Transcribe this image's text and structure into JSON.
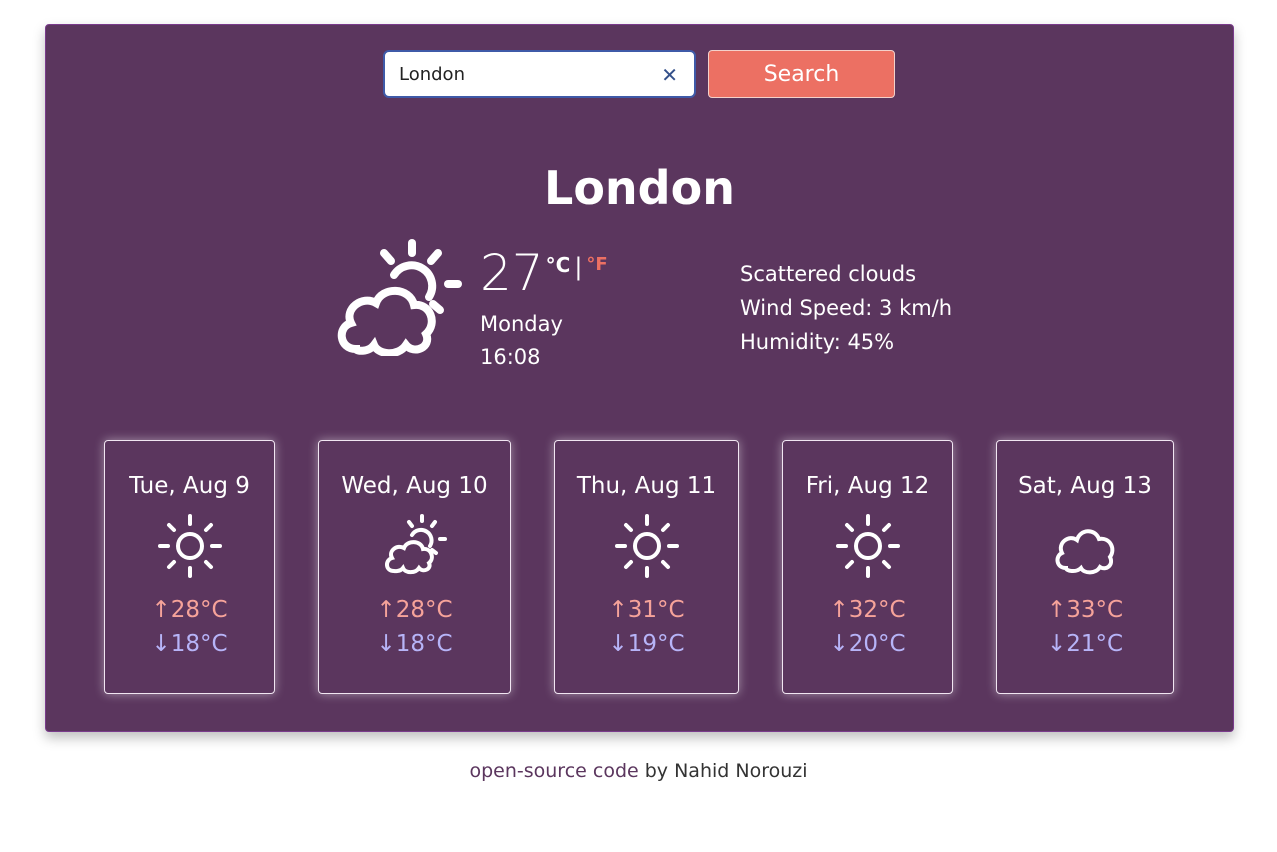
{
  "search": {
    "value": "London",
    "clear_glyph": "✕",
    "button_label": "Search"
  },
  "current": {
    "city": "London",
    "temperature": "27",
    "unit_celsius": "°C",
    "unit_separator": "|",
    "unit_fahrenheit": "°F",
    "day": "Monday",
    "time": "16:08",
    "description": "Scattered clouds",
    "wind": "Wind Speed: 3 km/h",
    "humidity": "Humidity: 45%",
    "icon": "partly-cloudy-icon"
  },
  "forecast": [
    {
      "date": "Tue, Aug 9",
      "icon": "sun-icon",
      "max": "↑28°C",
      "min": "↓18°C"
    },
    {
      "date": "Wed, Aug 10",
      "icon": "partly-cloudy-icon",
      "max": "↑28°C",
      "min": "↓18°C"
    },
    {
      "date": "Thu, Aug 11",
      "icon": "sun-icon",
      "max": "↑31°C",
      "min": "↓19°C"
    },
    {
      "date": "Fri, Aug 12",
      "icon": "sun-icon",
      "max": "↑32°C",
      "min": "↓20°C"
    },
    {
      "date": "Sat, Aug 13",
      "icon": "cloud-icon",
      "max": "↑33°C",
      "min": "↓21°C"
    }
  ],
  "footer": {
    "link_text": "open-source code",
    "suffix": " by Nahid Norouzi"
  },
  "colors": {
    "panel": "#5b365e",
    "accent": "#ec7063",
    "max_temp": "#f6a39a",
    "min_temp": "#b7b4f8"
  }
}
